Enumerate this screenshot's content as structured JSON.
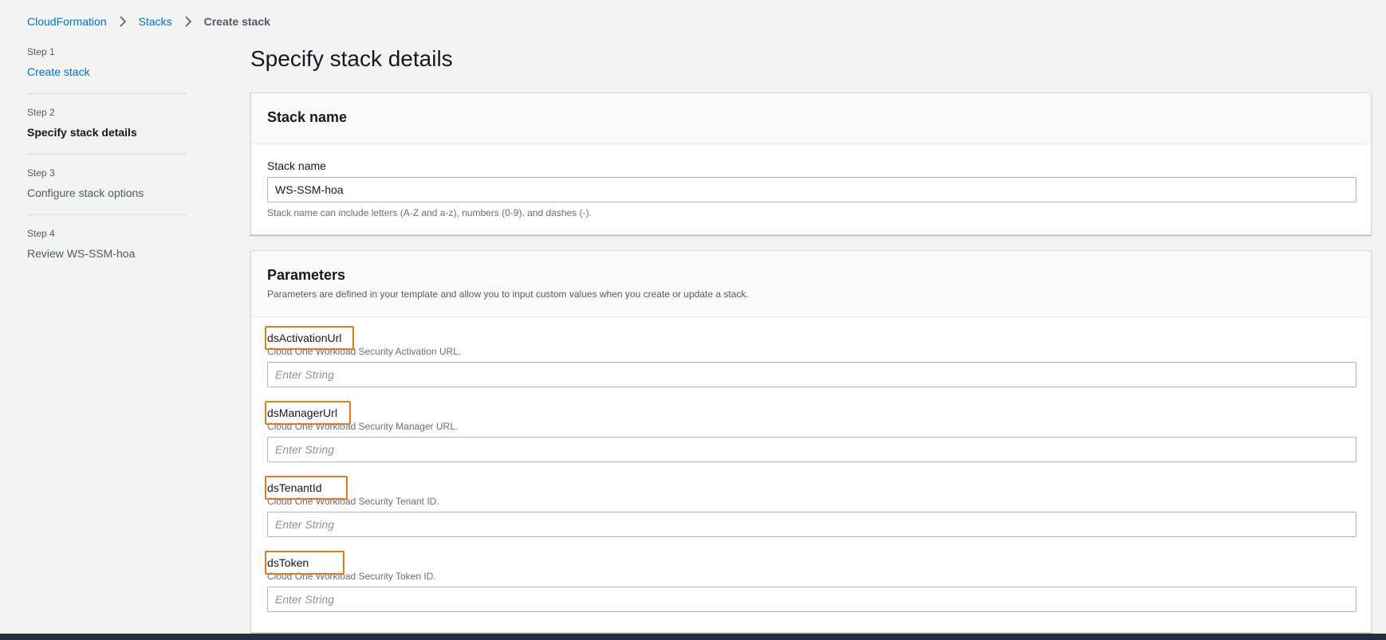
{
  "breadcrumb": {
    "items": [
      "CloudFormation",
      "Stacks"
    ],
    "current": "Create stack"
  },
  "steps": [
    {
      "num": "Step 1",
      "title": "Create stack",
      "state": "link"
    },
    {
      "num": "Step 2",
      "title": "Specify stack details",
      "state": "active"
    },
    {
      "num": "Step 3",
      "title": "Configure stack options",
      "state": "inactive"
    },
    {
      "num": "Step 4",
      "title": "Review WS-SSM-hoa",
      "state": "inactive"
    }
  ],
  "page_title": "Specify stack details",
  "stack_name_panel": {
    "header": "Stack name",
    "label": "Stack name",
    "value": "WS-SSM-hoa",
    "constraint": "Stack name can include letters (A-Z and a-z), numbers (0-9), and dashes (-)."
  },
  "parameters_panel": {
    "header": "Parameters",
    "description": "Parameters are defined in your template and allow you to input custom values when you create or update a stack.",
    "params": [
      {
        "name": "dsActivationUrl",
        "description": "Cloud One Workload Security Activation URL.",
        "placeholder": "Enter String",
        "value": ""
      },
      {
        "name": "dsManagerUrl",
        "description": "Cloud One Workload Security Manager URL.",
        "placeholder": "Enter String",
        "value": ""
      },
      {
        "name": "dsTenantId",
        "description": "Cloud One Workload Security Tenant ID.",
        "placeholder": "Enter String",
        "value": ""
      },
      {
        "name": "dsToken",
        "description": "Cloud One Workload Security Token ID.",
        "placeholder": "Enter String",
        "value": ""
      }
    ]
  },
  "colors": {
    "link": "#0073bb",
    "highlight": "#e07b1f",
    "background": "#f2f3f3"
  },
  "icons": {
    "breadcrumb_separator": "chevron-right-icon"
  }
}
